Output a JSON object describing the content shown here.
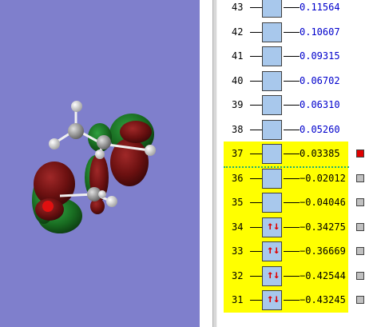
{
  "orbitals": [
    {
      "n": "43",
      "energy": "0.11564",
      "occupied": false,
      "highlight": false,
      "status": "none"
    },
    {
      "n": "42",
      "energy": "0.10607",
      "occupied": false,
      "highlight": false,
      "status": "none"
    },
    {
      "n": "41",
      "energy": "0.09315",
      "occupied": false,
      "highlight": false,
      "status": "none"
    },
    {
      "n": "40",
      "energy": "0.06702",
      "occupied": false,
      "highlight": false,
      "status": "none"
    },
    {
      "n": "39",
      "energy": "0.06310",
      "occupied": false,
      "highlight": false,
      "status": "none"
    },
    {
      "n": "38",
      "energy": "0.05260",
      "occupied": false,
      "highlight": false,
      "status": "none"
    },
    {
      "n": "37",
      "energy": "0.03385",
      "occupied": false,
      "highlight": true,
      "status": "selected"
    },
    {
      "n": "36",
      "energy": "−0.02012",
      "occupied": false,
      "highlight": true,
      "status": "unselected"
    },
    {
      "n": "35",
      "energy": "−0.04046",
      "occupied": false,
      "highlight": true,
      "status": "unselected"
    },
    {
      "n": "34",
      "energy": "−0.34275",
      "occupied": true,
      "highlight": true,
      "status": "unselected"
    },
    {
      "n": "33",
      "energy": "−0.36669",
      "occupied": true,
      "highlight": true,
      "status": "unselected"
    },
    {
      "n": "32",
      "energy": "−0.42544",
      "occupied": true,
      "highlight": true,
      "status": "unselected"
    },
    {
      "n": "31",
      "energy": "−0.43245",
      "occupied": true,
      "highlight": true,
      "status": "unselected"
    }
  ],
  "colors": {
    "viewport_bg": "#7f7fcc",
    "highlight": "#ffff00",
    "orbital_box": "#a8c8ec",
    "virtual_energy_text": "#0000cc",
    "selected_marker": "#e00000",
    "unselected_marker": "#c0c0c0",
    "homo_lumo_separator": "#20b070"
  },
  "icons": {
    "electron_pair": "up-down-arrows-icon"
  }
}
